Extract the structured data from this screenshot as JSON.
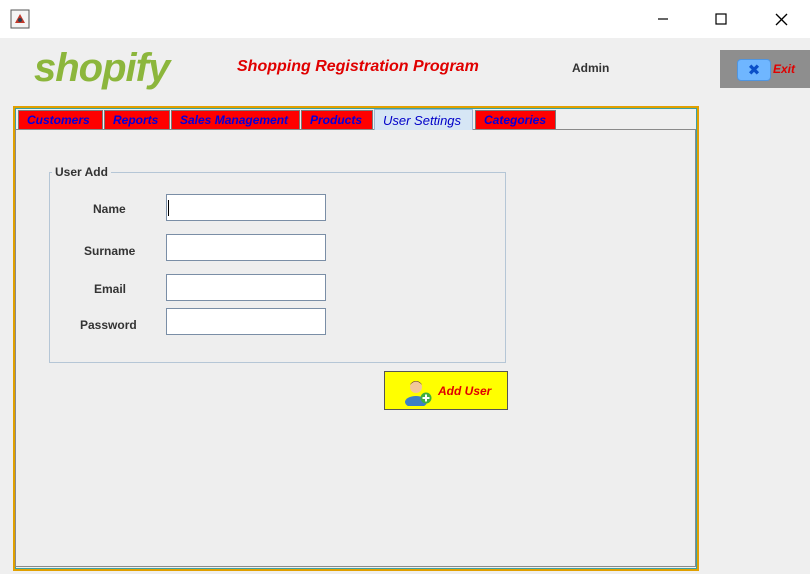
{
  "window": {
    "icon": "java-app-icon",
    "controls": {
      "minimize": "minimize-icon",
      "maximize": "maximize-icon",
      "close": "close-icon"
    }
  },
  "header": {
    "logo_text": "shopify",
    "title": "Shopping Registration Program",
    "user": "Admin",
    "exit_label": "Exit"
  },
  "tabs": [
    {
      "label": "Customers"
    },
    {
      "label": "Reports"
    },
    {
      "label": "Sales Management"
    },
    {
      "label": "Products"
    },
    {
      "label": "User Settings"
    },
    {
      "label": "Categories"
    }
  ],
  "active_tab": "User Settings",
  "form": {
    "group_title": "User Add",
    "fields": [
      {
        "label": "Name",
        "value": ""
      },
      {
        "label": "Surname",
        "value": ""
      },
      {
        "label": "Email",
        "value": ""
      },
      {
        "label": "Password",
        "value": ""
      }
    ],
    "submit_label": "Add User"
  },
  "colors": {
    "logo": "#8cb63c",
    "accent_red": "#e00000",
    "tab_red": "#ff0000",
    "tab_text": "#0000e0",
    "button_yellow": "#ffff00",
    "exit_bg": "#8e8e8e"
  }
}
